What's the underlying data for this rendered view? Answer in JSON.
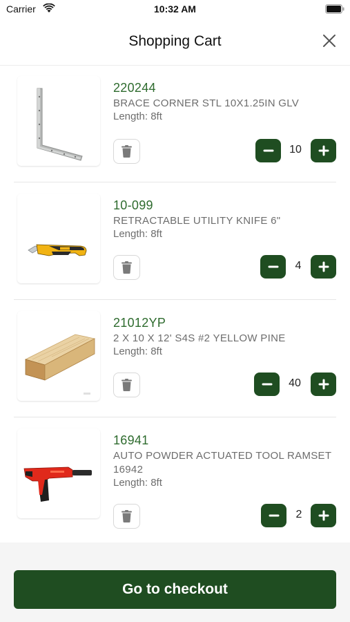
{
  "status_bar": {
    "carrier": "Carrier",
    "time": "10:32 AM"
  },
  "nav": {
    "title": "Shopping Cart"
  },
  "items": [
    {
      "sku": "220244",
      "description": "BRACE CORNER STL 10X1.25IN GLV",
      "length": "Length: 8ft",
      "quantity": "10",
      "image": "corner-brace"
    },
    {
      "sku": "10-099",
      "description": "RETRACTABLE UTILITY KNIFE 6\"",
      "length": "Length: 8ft",
      "quantity": "4",
      "image": "utility-knife"
    },
    {
      "sku": "21012YP",
      "description": "2 X 10 X 12' S4S #2 YELLOW PINE",
      "length": "Length: 8ft",
      "quantity": "40",
      "image": "lumber-board"
    },
    {
      "sku": "16941",
      "description": "AUTO POWDER ACTUATED TOOL RAMSET 16942",
      "length": "Length: 8ft",
      "quantity": "2",
      "image": "powder-actuated-tool"
    }
  ],
  "footer": {
    "checkout_label": "Go to checkout"
  },
  "colors": {
    "primary": "#1f4d21",
    "sku": "#2e6b2e",
    "secondary_text": "#6d6d6d"
  }
}
